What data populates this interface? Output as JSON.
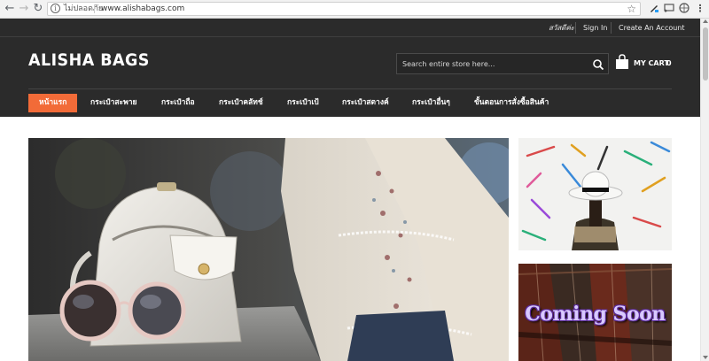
{
  "browser": {
    "back_icon": "arrow-left-icon",
    "forward_icon": "arrow-right-icon",
    "reload_icon": "reload-icon",
    "security_label": "ไม่ปลอดภัย",
    "url": "www.alishabags.com",
    "bookmark_icon": "star-icon",
    "menu_icon": "kebab-menu-icon"
  },
  "header": {
    "greeting": "สวัสดีค่ะ",
    "sign_in": "Sign In",
    "create_account": "Create An Account",
    "logo": "ALISHA BAGS",
    "search": {
      "placeholder": "Search entire store here...",
      "icon": "search-icon"
    },
    "cart": {
      "label": "MY CART",
      "count": "0",
      "icon": "shopping-bag-icon"
    }
  },
  "menu": {
    "items": [
      {
        "label": "หน้าแรก",
        "active": true
      },
      {
        "label": "กระเป๋าสะพาย",
        "active": false
      },
      {
        "label": "กระเป๋าถือ",
        "active": false
      },
      {
        "label": "กระเป๋าคลัทช์",
        "active": false
      },
      {
        "label": "กระเป๋าเป้",
        "active": false
      },
      {
        "label": "กระเป๋าสตางค์",
        "active": false
      },
      {
        "label": "กระเป๋าอื่นๆ",
        "active": false
      },
      {
        "label": "ขั้นตอนการสั่งซื้อสินค้า",
        "active": false
      }
    ]
  },
  "banners": {
    "side_bottom_text": "Coming Soon"
  },
  "colors": {
    "header_bg": "#2b2b2b",
    "accent": "#f26b38",
    "text_light": "#ffffff"
  }
}
